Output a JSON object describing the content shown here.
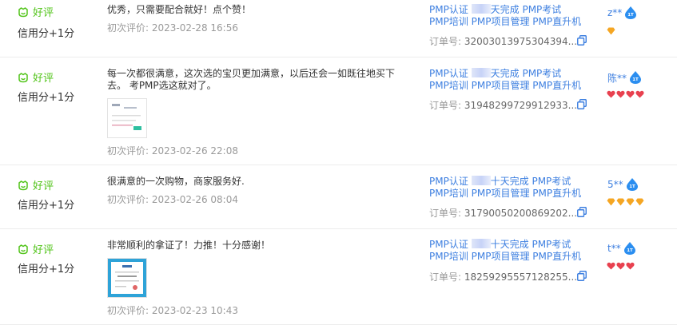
{
  "reviews": [
    {
      "rating_label": "好评",
      "credit": "信用分+1分",
      "comment": "优秀，只需要配合就好！点个赞！",
      "time": "初次评价: 2023-02-28 16:56",
      "product_line1_a": "PMP认证",
      "product_line1_b": "天完成 PMP考试",
      "product_line2": "PMP培训 PMP项目管理 PMP直升机",
      "order_label": "订单号:",
      "order_number": "32003013975304394...",
      "username": "z**",
      "level_icon": "diamond",
      "level_count": 1,
      "level_color": "#f5a623",
      "has_image": false
    },
    {
      "rating_label": "好评",
      "credit": "信用分+1分",
      "comment": "每一次都很满意，这次选的宝贝更加满意，以后还会一如既往地买下去。 考PMP选这就对了。",
      "time": "初次评价: 2023-02-26 22:08",
      "product_line1_a": "PMP认证",
      "product_line1_b": "天完成 PMP考试",
      "product_line2": "PMP培训 PMP项目管理 PMP直升机",
      "order_label": "订单号:",
      "order_number": "31948299729912933...",
      "username": "陈**",
      "level_icon": "heart",
      "level_count": 4,
      "level_color": "#e8414f",
      "has_image": true
    },
    {
      "rating_label": "好评",
      "credit": "信用分+1分",
      "comment": "很满意的一次购物，商家服务好.",
      "time": "初次评价: 2023-02-26 08:04",
      "product_line1_a": "PMP认证",
      "product_line1_b": "十天完成 PMP考试",
      "product_line2": "PMP培训 PMP项目管理 PMP直升机",
      "order_label": "订单号:",
      "order_number": "31790050200869202...",
      "username": "5**",
      "level_icon": "diamond",
      "level_count": 4,
      "level_color": "#f5a623",
      "has_image": false
    },
    {
      "rating_label": "好评",
      "credit": "信用分+1分",
      "comment": "非常顺利的拿证了！力推！十分感谢！",
      "time": "初次评价: 2023-02-23 10:43",
      "product_line1_a": "PMP认证",
      "product_line1_b": "十天完成 PMP考试",
      "product_line2": "PMP培训 PMP项目管理 PMP直升机",
      "order_label": "订单号:",
      "order_number": "18259295557128255...",
      "username": "t**",
      "level_icon": "heart",
      "level_count": 3,
      "level_color": "#e8414f",
      "has_image": true
    }
  ],
  "colors": {
    "positive": "#52c41a",
    "link": "#3d7fe0",
    "muted": "#9a9a9a",
    "badge": "#2b8ef0"
  },
  "icons": {
    "rating": "smile-flower-icon",
    "copy": "copy-icon",
    "user_badge": "water-drop-badge-icon"
  }
}
